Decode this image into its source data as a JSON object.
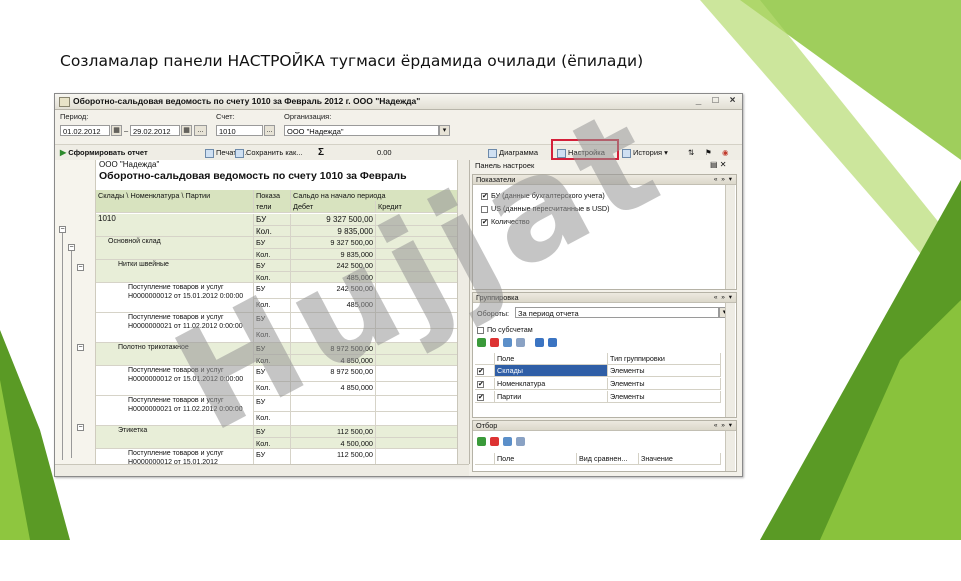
{
  "slide": {
    "title": "Созламалар панели НАСТРОЙКА тугмаси ёрдамида очилади (ёпилади)",
    "colors": {
      "green_light": "#9ccb3b",
      "green_dark": "#4f8a1e",
      "highlight": "#d4203a"
    }
  },
  "window": {
    "title": "Оборотно-сальдовая ведомость по счету 1010 за Февраль 2012 г. ООО \"Надежда\"",
    "controls": {
      "minimize": "_",
      "maximize": "□",
      "close": "×"
    }
  },
  "params": {
    "period_label": "Период:",
    "date_from": "01.02.2012",
    "date_sep": "–",
    "date_to": "29.02.2012",
    "account_label": "Счет:",
    "account_value": "1010",
    "org_label": "Организация:",
    "org_value": "ООО \"Надежда\"",
    "ellipsis": "..."
  },
  "toolbar": {
    "run": "Сформировать отчет",
    "print": "Печать...",
    "save": "Сохранить как...",
    "sum_icon": "Σ",
    "sum_value": "0.00",
    "diagram": "Диаграмма",
    "settings": "Настройка",
    "history": "История"
  },
  "report": {
    "org": "ООО \"Надежда\"",
    "heading": "Оборотно-сальдовая ведомость по счету 1010 за Февраль",
    "columns": {
      "groups": "Склады \\ Номенклатура \\ Партии",
      "ind1": "Показа",
      "ind2": "тели",
      "saldo": "Сальдо на начало периода",
      "debit": "Дебет",
      "credit": "Кредит"
    },
    "rows": [
      {
        "name": "1010",
        "ind": [
          "БУ",
          "Кол."
        ],
        "debit": [
          "9 327 500,00",
          "9 835,000"
        ],
        "level": 0
      },
      {
        "name": "Основной склад",
        "ind": [
          "БУ",
          "Кол."
        ],
        "debit": [
          "9 327 500,00",
          "9 835,000"
        ],
        "level": 1
      },
      {
        "name": "Нитки швейные",
        "ind": [
          "БУ",
          "Кол."
        ],
        "debit": [
          "242 500,00",
          "485,000"
        ],
        "level": 2
      },
      {
        "name": "Поступление товаров и услуг Н0000000012 от 15.01.2012 0:00:00",
        "ind": [
          "БУ",
          "Кол."
        ],
        "debit": [
          "242 500,00",
          "485,000"
        ],
        "level": 3
      },
      {
        "name": "Поступление товаров и услуг Н0000000021 от 11.02.2012 0:00:00",
        "ind": [
          "БУ",
          "Кол."
        ],
        "debit": [
          "",
          ""
        ],
        "level": 3
      },
      {
        "name": "Полотно трикотажное",
        "ind": [
          "БУ",
          "Кол."
        ],
        "debit": [
          "8 972 500,00",
          "4 850,000"
        ],
        "level": 2
      },
      {
        "name": "Поступление товаров и услуг Н0000000012 от 15.01.2012 0:00:00",
        "ind": [
          "БУ",
          "Кол."
        ],
        "debit": [
          "8 972 500,00",
          "4 850,000"
        ],
        "level": 3
      },
      {
        "name": "Поступление товаров и услуг Н0000000021 от 11.02.2012 0:00:00",
        "ind": [
          "БУ",
          "Кол."
        ],
        "debit": [
          "",
          ""
        ],
        "level": 3
      },
      {
        "name": "Этикетка",
        "ind": [
          "БУ",
          "Кол."
        ],
        "debit": [
          "112 500,00",
          "4 500,000"
        ],
        "level": 2
      },
      {
        "name": "Поступление товаров и услуг Н0000000012 от 15.01.2012",
        "ind": [
          "БУ",
          "Кол."
        ],
        "debit": [
          "112 500,00",
          "4 500,000"
        ],
        "level": 3
      }
    ]
  },
  "panel": {
    "title": "Панель настроек",
    "indicators": {
      "header": "Показатели",
      "items": [
        {
          "label": "БУ (данные бухгалтерского учета)",
          "checked": true
        },
        {
          "label": "US (данные пересчитанные в USD)",
          "checked": false
        },
        {
          "label": "Количество",
          "checked": true
        }
      ]
    },
    "grouping": {
      "header": "Группировка",
      "turnover_label": "Обороты:",
      "turnover_value": "За период отчета",
      "by_subaccounts": "По субсчетам",
      "col_field": "Поле",
      "col_type": "Тип группировки",
      "rows": [
        {
          "field": "Склады",
          "type": "Элементы",
          "checked": true
        },
        {
          "field": "Номенклатура",
          "type": "Элементы",
          "checked": true
        },
        {
          "field": "Партии",
          "type": "Элементы",
          "checked": true
        }
      ]
    },
    "filter": {
      "header": "Отбор",
      "col_field": "Поле",
      "col_compare": "Вид сравнен...",
      "col_value": "Значение"
    },
    "section_controls": "« » ▾"
  }
}
